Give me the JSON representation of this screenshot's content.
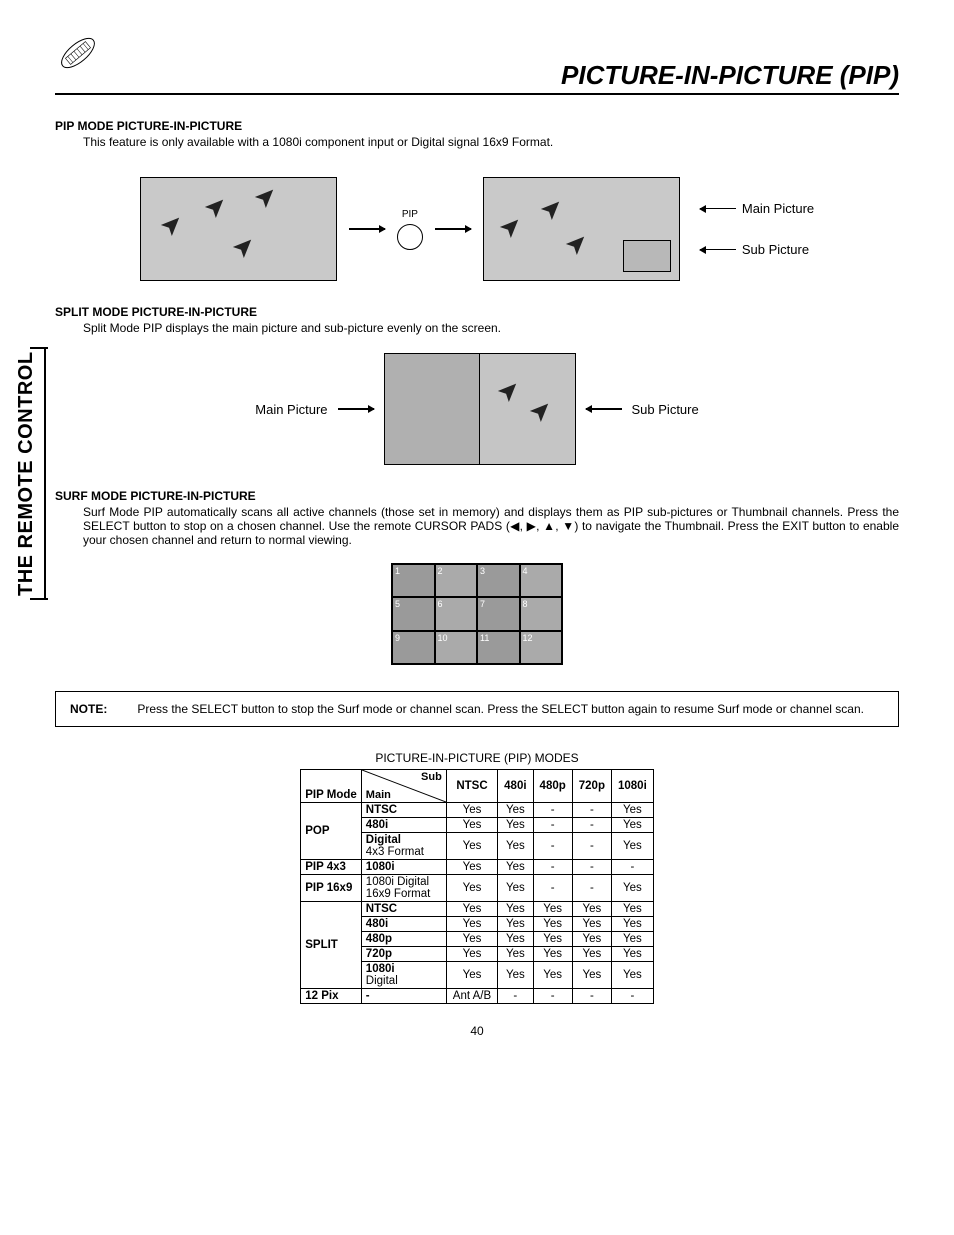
{
  "page_title": "PICTURE-IN-PICTURE (PIP)",
  "side_label": "THE REMOTE CONTROL",
  "page_number": "40",
  "sec1": {
    "heading": "PIP MODE PICTURE-IN-PICTURE",
    "desc": "This feature is only available with a 1080i component input or Digital signal 16x9 Format.",
    "btn_label": "PIP",
    "label_main": "Main Picture",
    "label_sub": "Sub Picture"
  },
  "sec2": {
    "heading": "SPLIT MODE PICTURE-IN-PICTURE",
    "desc": "Split Mode PIP displays the main picture and sub-picture evenly on the screen.",
    "label_main": "Main Picture",
    "label_sub": "Sub Picture"
  },
  "sec3": {
    "heading": "SURF MODE PICTURE-IN-PICTURE",
    "desc": "Surf Mode PIP automatically scans all active channels (those set in memory) and displays them as PIP sub-pictures or Thumbnail channels.  Press the SELECT button to stop on a chosen channel.  Use the remote CURSOR PADS (◀, ▶, ▲, ▼) to navigate the Thumbnail.  Press the EXIT button to enable your chosen channel and return to normal viewing.",
    "cells": [
      "1",
      "2",
      "3",
      "4",
      "5",
      "6",
      "7",
      "8",
      "9",
      "10",
      "11",
      "12"
    ]
  },
  "note": {
    "label": "NOTE:",
    "text": "Press the SELECT button to stop the Surf mode or channel scan.  Press the SELECT button again to resume Surf mode or channel scan."
  },
  "table_caption": "PICTURE-IN-PICTURE (PIP) MODES",
  "chart_data": {
    "type": "table",
    "corner": {
      "sub": "Sub",
      "main": "Main"
    },
    "mode_header": "PIP Mode",
    "columns": [
      "NTSC",
      "480i",
      "480p",
      "720p",
      "1080i"
    ],
    "rows": [
      {
        "mode": "POP",
        "main": "NTSC",
        "vals": [
          "Yes",
          "Yes",
          "-",
          "-",
          "Yes"
        ]
      },
      {
        "mode": "",
        "main": "480i",
        "vals": [
          "Yes",
          "Yes",
          "-",
          "-",
          "Yes"
        ]
      },
      {
        "mode": "",
        "main": "Digital 4x3 Format",
        "main_bold_first": "Digital",
        "vals": [
          "Yes",
          "Yes",
          "-",
          "-",
          "Yes"
        ]
      },
      {
        "mode": "PIP 4x3",
        "main": "1080i",
        "vals": [
          "Yes",
          "Yes",
          "-",
          "-",
          "-"
        ]
      },
      {
        "mode": "PIP 16x9",
        "main": "1080i Digital 16x9 Format",
        "main_norm": true,
        "vals": [
          "Yes",
          "Yes",
          "-",
          "-",
          "Yes"
        ]
      },
      {
        "mode": "SPLIT",
        "main": "NTSC",
        "vals": [
          "Yes",
          "Yes",
          "Yes",
          "Yes",
          "Yes"
        ]
      },
      {
        "mode": "",
        "main": "480i",
        "vals": [
          "Yes",
          "Yes",
          "Yes",
          "Yes",
          "Yes"
        ]
      },
      {
        "mode": "",
        "main": "480p",
        "vals": [
          "Yes",
          "Yes",
          "Yes",
          "Yes",
          "Yes"
        ]
      },
      {
        "mode": "",
        "main": "720p",
        "vals": [
          "Yes",
          "Yes",
          "Yes",
          "Yes",
          "Yes"
        ]
      },
      {
        "mode": "",
        "main": "1080i Digital",
        "main_bold_first": "1080i",
        "vals": [
          "Yes",
          "Yes",
          "Yes",
          "Yes",
          "Yes"
        ]
      },
      {
        "mode": "12 Pix",
        "main": "-",
        "vals": [
          "Ant A/B",
          "-",
          "-",
          "-",
          "-"
        ]
      }
    ]
  }
}
